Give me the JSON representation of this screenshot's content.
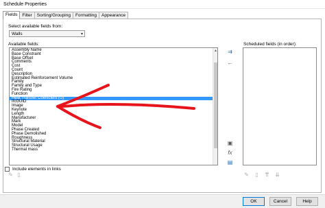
{
  "window": {
    "title": "Schedule Properties"
  },
  "tabs": [
    "Fields",
    "Filter",
    "Sorting/Grouping",
    "Formatting",
    "Appearance"
  ],
  "fields_tab": {
    "select_label": "Select available fields from:",
    "select_value": "Walls",
    "available_label": "Available fields:",
    "scheduled_label": "Scheduled fields (in order):",
    "available_fields": [
      "Assembly Name",
      "Base Constraint",
      "Base Offset",
      "Comments",
      "Cost",
      "Count",
      "Description",
      "Estimated Reinforcement Volume",
      "Family",
      "Family and Type",
      "Fire Rating",
      "Function",
      "Heat Transfer Coefficient (U)",
      "IfcGUID",
      "Image",
      "Keynote",
      "Length",
      "Manufacturer",
      "Mark",
      "Model",
      "Phase Created",
      "Phase Demolished",
      "Roughness",
      "Structural Material",
      "Structural Usage",
      "Thermal mass"
    ],
    "selected_index": 12,
    "include_links_label": "Include elements in links",
    "include_links_checked": false
  },
  "buttons": {
    "ok": "OK",
    "cancel": "Cancel",
    "help": "Help"
  },
  "icons": {
    "add": "add-parameter-icon",
    "remove": "remove-parameter-icon",
    "new_param": "new-parameter-icon",
    "formula": "formula-icon",
    "combine": "combine-parameters-icon",
    "edit": "edit-icon",
    "delete": "delete-icon"
  },
  "annotation": {
    "color": "#e8141c"
  }
}
